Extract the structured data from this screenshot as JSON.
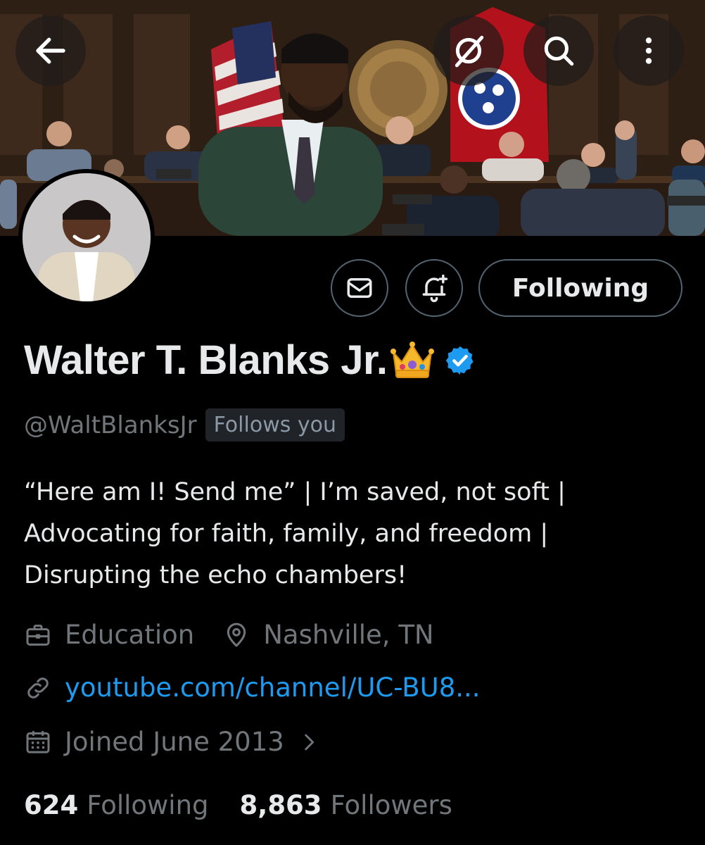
{
  "header": {
    "back_icon": "arrow-left-icon",
    "grok_icon": "grok-icon",
    "search_icon": "search-icon",
    "more_icon": "more-vertical-icon"
  },
  "actions": {
    "message_icon": "envelope-icon",
    "notify_icon": "bell-plus-icon",
    "following_label": "Following"
  },
  "profile": {
    "display_name": "Walter T. Blanks Jr.",
    "name_emoji": "crown",
    "verified": true,
    "handle": "@WaltBlanksJr",
    "follows_you_label": "Follows you",
    "bio": "“Here am I! Send me” | I’m saved, not soft |\nAdvocating for faith, family, and freedom |\nDisrupting the echo chambers!",
    "category": "Education",
    "location": "Nashville, TN",
    "website": "youtube.com/channel/UC-BU8...",
    "joined": "Joined June 2013"
  },
  "stats": {
    "following_count": "624",
    "following_label": "Following",
    "followers_count": "8,863",
    "followers_label": "Followers"
  },
  "colors": {
    "background": "#000000",
    "text_primary": "#e7e9ea",
    "text_secondary": "#71767b",
    "link": "#1d9bf0",
    "verified": "#1d9bf0",
    "border": "#536471"
  }
}
